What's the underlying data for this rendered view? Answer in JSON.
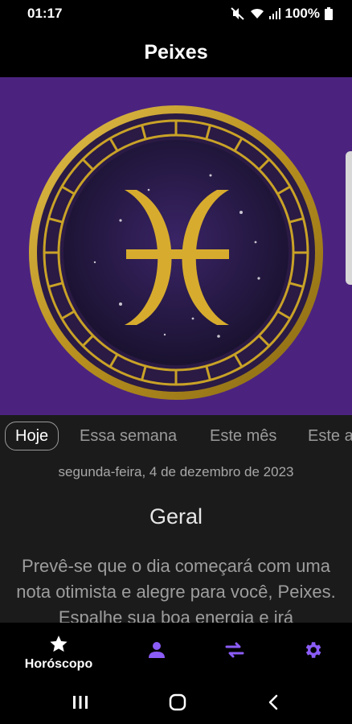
{
  "status": {
    "time": "01:17",
    "battery": "100%"
  },
  "appbar": {
    "title": "Peixes"
  },
  "tabs": [
    "Hoje",
    "Essa semana",
    "Este mês",
    "Este a"
  ],
  "content": {
    "date": "segunda-feira, 4 de dezembro de 2023",
    "section_title": "Geral",
    "text": "Prevê-se que o dia começará com uma nota otimista e alegre para você, Peixes. Espalhe sua boa energia e irá"
  },
  "bottom_nav": {
    "items": [
      {
        "label": "Horóscopo",
        "icon": "star-icon"
      },
      {
        "label": "",
        "icon": "person-icon"
      },
      {
        "label": "",
        "icon": "swap-icon"
      },
      {
        "label": "",
        "icon": "gear-icon"
      }
    ]
  },
  "colors": {
    "hero_bg": "#4b237f",
    "accent": "#8b5cf6",
    "gold": "#c9a227",
    "dark_panel": "#1b1b1b"
  }
}
